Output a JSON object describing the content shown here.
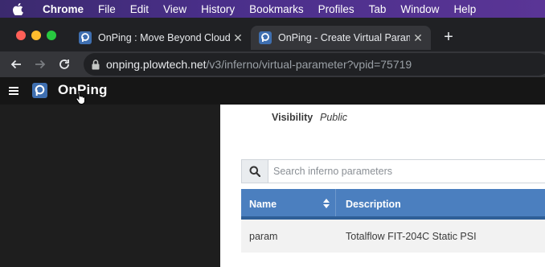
{
  "menubar": {
    "app_name": "Chrome",
    "items": [
      "File",
      "Edit",
      "View",
      "History",
      "Bookmarks",
      "Profiles",
      "Tab",
      "Window",
      "Help"
    ]
  },
  "tabs": [
    {
      "title": "OnPing : Move Beyond Cloud S",
      "active": false
    },
    {
      "title": "OnPing - Create Virtual Parame",
      "active": true
    }
  ],
  "address_bar": {
    "host": "onping.plowtech.net",
    "path": "/v3/inferno/virtual-parameter?vpid=75719"
  },
  "app": {
    "logo_text": "OnPing"
  },
  "details": {
    "visibility_label": "Visibility",
    "visibility_value": "Public"
  },
  "search": {
    "placeholder": "Search inferno parameters",
    "value": ""
  },
  "table": {
    "columns": [
      "Name",
      "Description"
    ],
    "rows": [
      {
        "name": "param",
        "description": "Totalflow FIT-204C Static PSI"
      }
    ]
  },
  "colors": {
    "menubar": "#4a2f8a",
    "table_header": "#4b7fbf",
    "brand": "#2d5d9b"
  }
}
